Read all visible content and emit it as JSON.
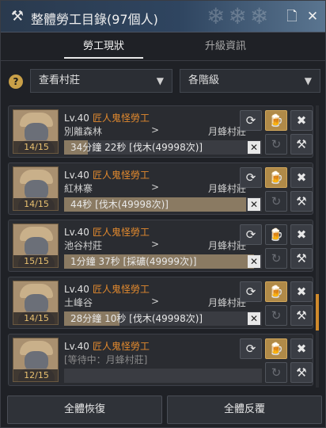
{
  "window": {
    "title": "整體勞工目錄(97個人)",
    "colors": {
      "accent": "#e38a2e",
      "gold_button": "#b08a48",
      "scroll_thumb": "#d08a2c"
    }
  },
  "tabs": [
    {
      "label": "勞工現狀",
      "active": true
    },
    {
      "label": "升級資訊",
      "active": false
    }
  ],
  "filters": {
    "help_label": "?",
    "town_select": "查看村莊",
    "grade_select": "各階級"
  },
  "workers": [
    {
      "level": "Lv.40",
      "name": "匠人鬼怪勞工",
      "from": "別離森林",
      "sep": ">",
      "to": "月蜂村莊",
      "stamina": "14/15",
      "task": "34分鐘 22秒 [伐木(49998次)]",
      "progress": 0.12,
      "drink_active": false
    },
    {
      "level": "Lv.40",
      "name": "匠人鬼怪勞工",
      "from": "紅林寨",
      "sep": ">",
      "to": "月蜂村莊",
      "stamina": "14/15",
      "task": "44秒 [伐木(49998次)]",
      "progress": 0.92,
      "drink_active": false
    },
    {
      "level": "Lv.40",
      "name": "匠人鬼怪勞工",
      "from": "池谷村莊",
      "sep": ">",
      "to": "月蜂村莊",
      "stamina": "15/15",
      "task": "1分鐘 37秒 [採礦(49999次)]",
      "progress": 0.96,
      "drink_active": true
    },
    {
      "level": "Lv.40",
      "name": "匠人鬼怪勞工",
      "from": "土峰谷",
      "sep": ">",
      "to": "月蜂村莊",
      "stamina": "14/15",
      "task": "28分鐘 10秒 [伐木(49998次)]",
      "progress": 0.28,
      "drink_active": false
    },
    {
      "level": "Lv.40",
      "name": "匠人鬼怪勞工",
      "waiting_text": "[等待中：月蜂村莊]",
      "stamina": "12/15",
      "task": "",
      "progress": 0,
      "drink_active": false
    }
  ],
  "footer": {
    "recover_all": "全體恢復",
    "repeat_all": "全體反覆"
  },
  "icons": {
    "title": "worker-pickaxe-icon",
    "close_x": "close-icon",
    "pin": "pin-icon",
    "sprint": "speed-icon",
    "drink": "beer-mug-icon",
    "fire": "fire-worker-icon",
    "repeat": "repeat-icon",
    "work": "pickaxe-icon"
  }
}
